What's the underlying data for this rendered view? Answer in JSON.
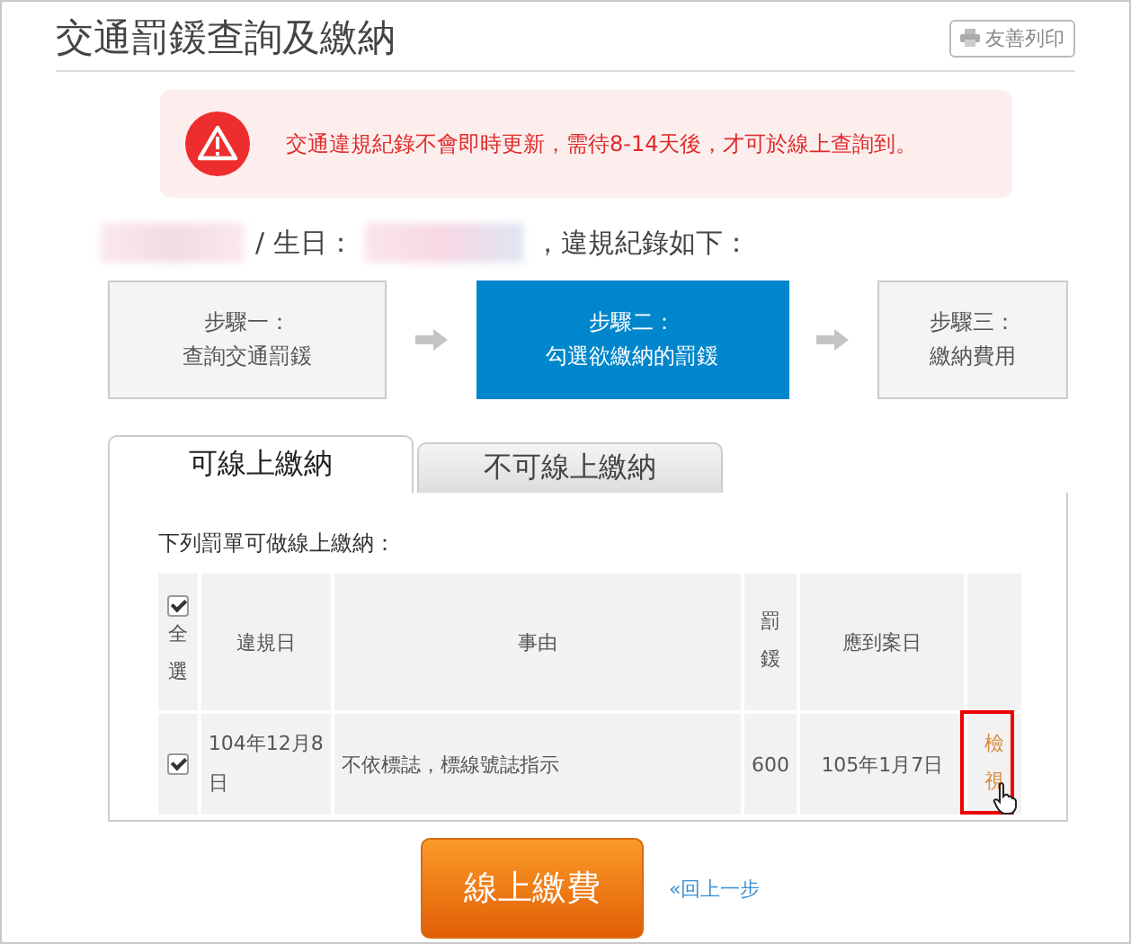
{
  "page": {
    "title": "交通罰鍰查詢及繳納",
    "print_button": "友善列印"
  },
  "alert": {
    "message": "交通違規紀錄不會即時更新，需待8-14天後，才可於線上查詢到。"
  },
  "record_line": {
    "separator": "/ 生日：",
    "suffix": "，違規紀錄如下："
  },
  "steps": [
    {
      "label": "步驟一：",
      "detail": "查詢交通罰鍰",
      "selected": false
    },
    {
      "label": "步驟二：",
      "detail": "勾選欲繳納的罰鍰",
      "selected": true
    },
    {
      "label": "步驟三：",
      "detail": "繳納費用",
      "selected": false
    }
  ],
  "tabs": [
    {
      "label": "可線上繳納",
      "selected": true
    },
    {
      "label": "不可線上繳納",
      "selected": false
    }
  ],
  "table": {
    "caption": "下列罰單可做線上繳納：",
    "select_all": {
      "label": "全選",
      "checked": true
    },
    "columns": [
      "違規日",
      "事由",
      "罰鍰",
      "應到案日"
    ],
    "rows": [
      {
        "checked": true,
        "date": "104年12月8日",
        "reason": "不依標誌，標線號誌指示",
        "amount": "600",
        "due": "105年1月7日",
        "action": "檢視",
        "highlighted": true
      }
    ]
  },
  "pay_button": "線上繳費",
  "back_link": "«回上一步"
}
